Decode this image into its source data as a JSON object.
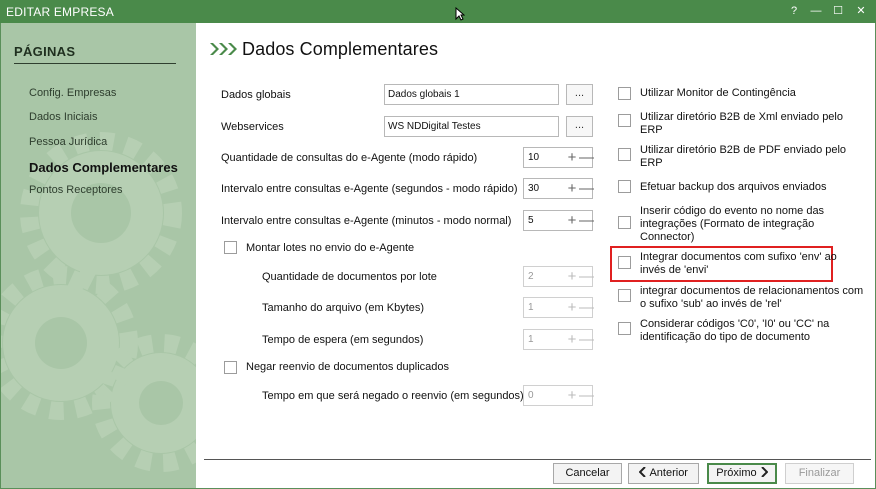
{
  "window": {
    "title": "EDITAR EMPRESA",
    "controls": {
      "help": "?",
      "minimize": "—",
      "maximize": "☐",
      "close": "✕"
    }
  },
  "sidebar": {
    "title": "PÁGINAS",
    "items": [
      {
        "label": "Config. Empresas",
        "active": false
      },
      {
        "label": "Dados Iniciais",
        "active": false
      },
      {
        "label": "Pessoa Jurídica",
        "active": false
      },
      {
        "label": "Dados Complementares",
        "active": true
      },
      {
        "label": "Pontos Receptores",
        "active": false
      }
    ]
  },
  "page": {
    "title": "Dados Complementares",
    "accent_color": "#4a8a4a"
  },
  "left": {
    "dados_globais": {
      "label": "Dados globais",
      "value": "Dados globais 1",
      "button": "..."
    },
    "webservices": {
      "label": "Webservices",
      "value": "WS NDDigital Testes",
      "button": "..."
    },
    "qtd_consultas": {
      "label": "Quantidade de consultas do e-Agente (modo rápido)",
      "value": "10"
    },
    "intervalo_rapido": {
      "label": "Intervalo entre consultas e-Agente (segundos - modo rápido)",
      "value": "30"
    },
    "intervalo_normal": {
      "label": "Intervalo entre consultas e-Agente (minutos - modo normal)",
      "value": "5"
    },
    "montar_lotes": {
      "label": "Montar lotes no envio do e-Agente",
      "checked": false
    },
    "qtd_documentos": {
      "label": "Quantidade de documentos por lote",
      "value": "2"
    },
    "tamanho_arquivo": {
      "label": "Tamanho do arquivo (em Kbytes)",
      "value": "1"
    },
    "tempo_espera": {
      "label": "Tempo de espera (em segundos)",
      "value": "1"
    },
    "negar_reenvio": {
      "label": "Negar reenvio de documentos duplicados",
      "checked": false
    },
    "tempo_negado": {
      "label": "Tempo em que será negado o reenvio (em segundos)",
      "value": "0"
    },
    "stepper_plus": "+",
    "stepper_minus": "—"
  },
  "right": {
    "options": [
      {
        "line1": "Utilizar Monitor de Contingência",
        "line2": "",
        "line3": "",
        "checked": false
      },
      {
        "line1": "Utilizar diretório B2B de Xml enviado pelo",
        "line2": "ERP",
        "line3": "",
        "checked": false
      },
      {
        "line1": "Utilizar diretório B2B de PDF enviado pelo",
        "line2": "ERP",
        "line3": "",
        "checked": false
      },
      {
        "line1": "Efetuar backup dos arquivos enviados",
        "line2": "",
        "line3": "",
        "checked": false
      },
      {
        "line1": "Inserir código do evento no nome das",
        "line2": "integrações (Formato de integração",
        "line3": "Connector)",
        "checked": false
      },
      {
        "line1": "Integrar documentos com sufixo 'env' ao",
        "line2": "invés de 'envi'",
        "line3": "",
        "checked": false,
        "highlighted": true,
        "highlight_color": "#e02020"
      },
      {
        "line1": "integrar documentos de relacionamentos com",
        "line2": "o sufixo 'sub' ao invés de 'rel'",
        "line3": "",
        "checked": false
      },
      {
        "line1": "Considerar códigos 'C0', 'I0' ou 'CC' na",
        "line2": "identificação do tipo de documento",
        "line3": "",
        "checked": false
      }
    ]
  },
  "footer": {
    "cancel": "Cancelar",
    "previous": "Anterior",
    "next": "Próximo",
    "finish": "Finalizar"
  }
}
